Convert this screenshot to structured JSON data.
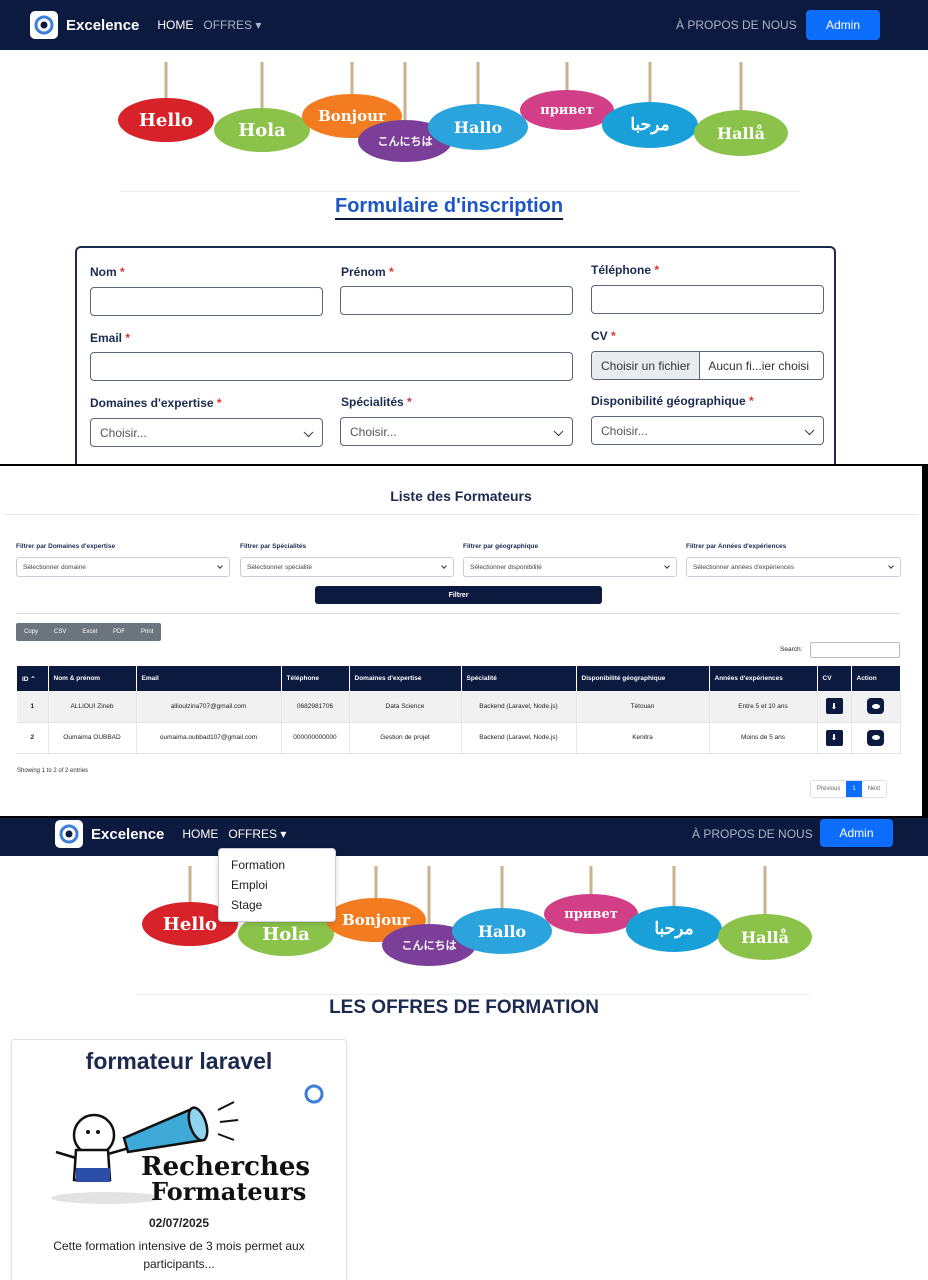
{
  "brand": "Excelence",
  "nav": {
    "home": "HOME",
    "offres": "OFFRES",
    "about": "À PROPOS DE NOUS",
    "admin": "Admin"
  },
  "greetings": [
    "Hello",
    "Hola",
    "Bonjour",
    "こんにちは",
    "Hallo",
    "привет",
    "مرحبا",
    "Hallå"
  ],
  "colors": {
    "navy": "#0c1a3f",
    "accent": "#0d6efd",
    "title_blue": "#1e56c8"
  },
  "form": {
    "title": "Formulaire d'inscription",
    "nom": "Nom",
    "prenom": "Prénom",
    "telephone": "Téléphone",
    "email": "Email",
    "cv": "CV",
    "file_choose": "Choisir un fichier",
    "file_none": "Aucun fi...ier choisi",
    "domaines": "Domaines d'expertise",
    "specialites": "Spécialités",
    "dispo": "Disponibilité géographique",
    "choose": "Choisir...",
    "required_mark": "*"
  },
  "list": {
    "title": "Liste des Formateurs",
    "filters": [
      {
        "label": "Filtrer par Domaines d'expertise",
        "value": "Sélectionner domaine"
      },
      {
        "label": "Filtrer par Spécialités",
        "value": "Sélectionner spécialité"
      },
      {
        "label": "Filtrer par géographique",
        "value": "Sélectionner disponibilité"
      },
      {
        "label": "Filtrer par Années d'expériences",
        "value": "Sélectionner années d'expériences"
      }
    ],
    "filter_button": "Filtrer",
    "export_buttons": [
      "Copy",
      "CSV",
      "Excel",
      "PDF",
      "Print"
    ],
    "search_label": "Search:",
    "headers": [
      "ID",
      "Nom & prénom",
      "Email",
      "Téléphone",
      "Domaines d'expertise",
      "Spécialité",
      "Disponibilité géographique",
      "Années d'expériences",
      "CV",
      "Action"
    ],
    "rows": [
      {
        "id": "1",
        "name": "ALLIOUI Zineb",
        "email": "allioulzina707@gmail.com",
        "phone": "0682981706",
        "domaine": "Data Science",
        "specialite": "Backend (Laravel, Node.js)",
        "dispo": "Tétouan",
        "annees": "Entre 5 et 10 ans"
      },
      {
        "id": "2",
        "name": "Oumaima OUBBAD",
        "email": "oumaima.oubbad107@gmail.com",
        "phone": "000000000000",
        "domaine": "Gestion de projet",
        "specialite": "Backend (Laravel, Node.js)",
        "dispo": "Kenitra",
        "annees": "Moins de 5 ans"
      }
    ],
    "showing": "Showing 1 to 2 of 2 entries",
    "pager": {
      "prev": "Previous",
      "page": "1",
      "next": "Next"
    }
  },
  "dropdown": [
    "Formation",
    "Emploi",
    "Stage"
  ],
  "offers": {
    "title": "LES OFFRES DE FORMATION",
    "card": {
      "title": "formateur laravel",
      "image_text_1": "Recherches",
      "image_text_2": "Formateurs",
      "date": "02/07/2025",
      "desc": "Cette formation intensive de 3 mois permet aux participants..."
    }
  }
}
